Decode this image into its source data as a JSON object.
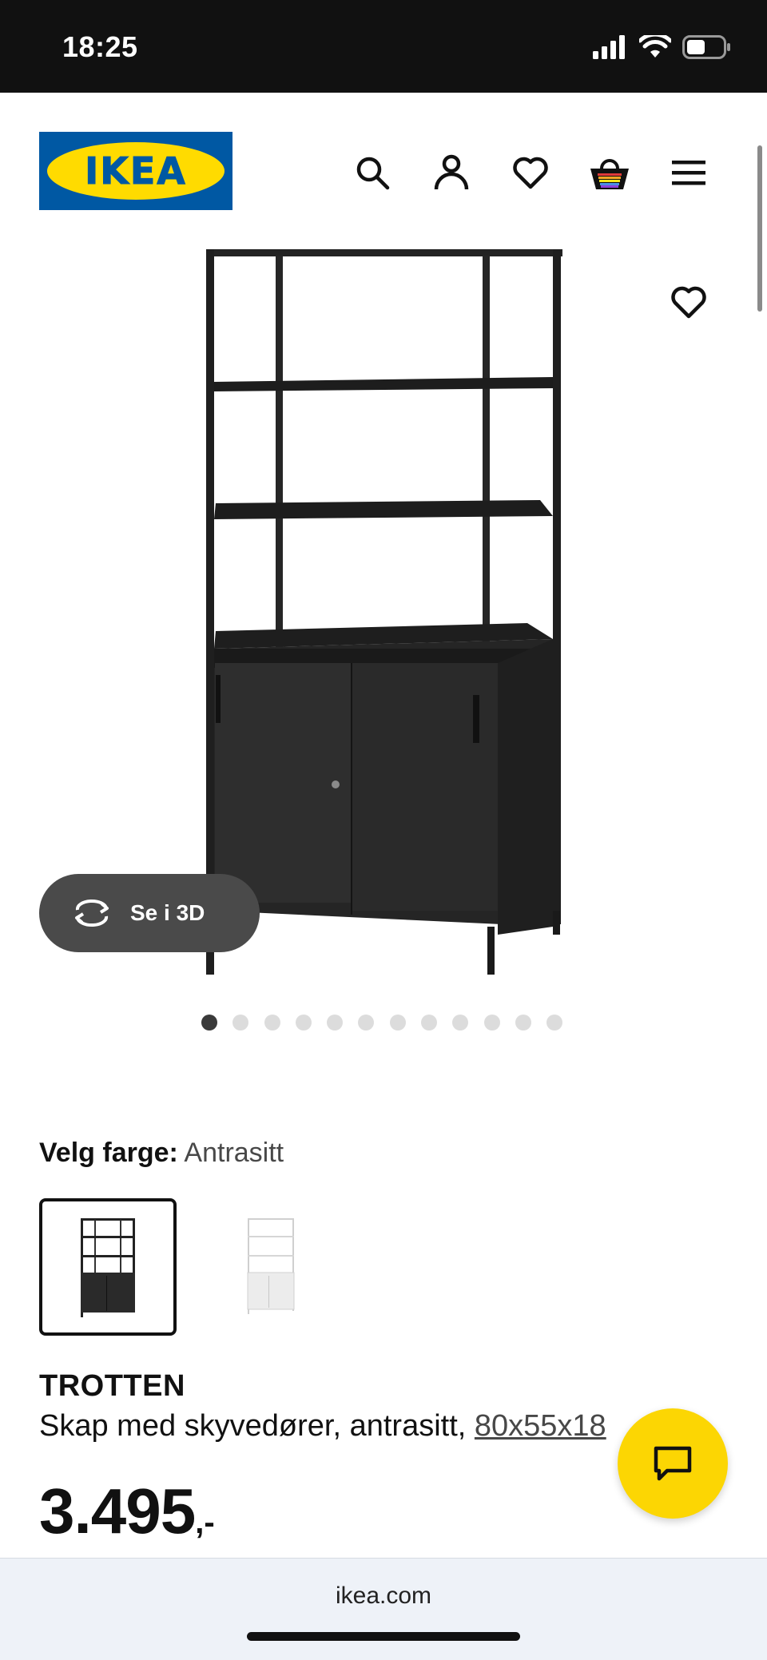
{
  "status_bar": {
    "time": "18:25",
    "icons": [
      "signal-icon",
      "wifi-icon",
      "battery-icon"
    ]
  },
  "header": {
    "logo_text": "IKEA",
    "icons": [
      "search-icon",
      "account-icon",
      "wishlist-icon",
      "cart-icon",
      "menu-icon"
    ]
  },
  "gallery": {
    "see_3d_label": "Se i 3D",
    "dot_count": 12,
    "active_index": 0
  },
  "color_picker": {
    "label": "Velg farge:",
    "value": "Antrasitt",
    "options": [
      "Antrasitt",
      "Hvit"
    ]
  },
  "product": {
    "name": "TROTTEN",
    "description": "Skap med skyvedører, antrasitt,",
    "size": "80x55x18",
    "price": "3.495",
    "price_suffix": ",-"
  },
  "browser": {
    "url": "ikea.com"
  },
  "colors": {
    "ikea_blue": "#0058a3",
    "ikea_yellow": "#ffdb00",
    "chat_yellow": "#fcd603"
  }
}
